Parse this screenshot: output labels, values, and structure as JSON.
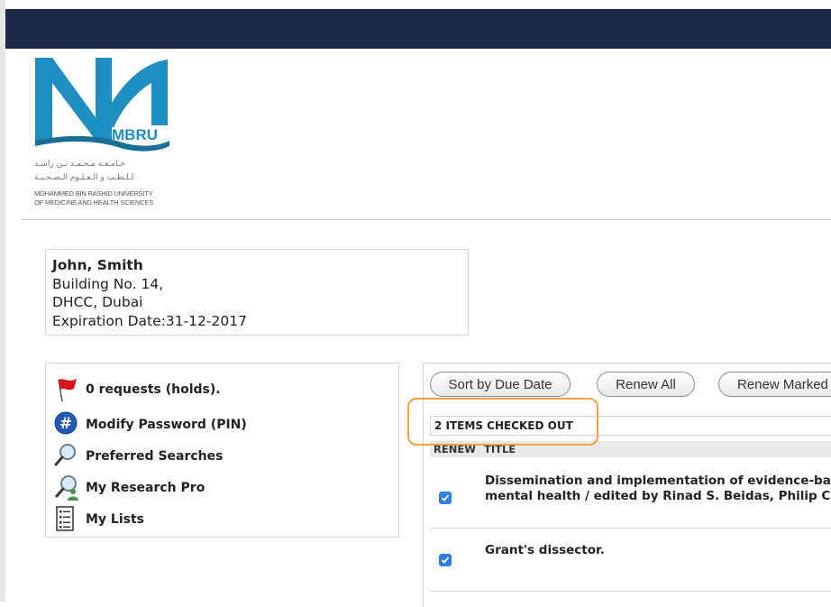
{
  "logo": {
    "acronym": "MBRU",
    "arabic_line1": "جـامـعـة مـحـمـد بـن راشـد",
    "arabic_line2": "لـلـطـب و الـعـلـوم الـصـحـيـة",
    "english_line1": "MOHAMMED BIN RASHID UNIVERSITY",
    "english_line2": "OF MEDICINE AND HEALTH SCIENCES",
    "brand_color": "#1f8fc1",
    "accent_color": "#1a6e96"
  },
  "patron": {
    "name": "John, Smith",
    "address_line1": "Building No. 14,",
    "address_line2": "DHCC, Dubai",
    "expiration": "Expiration Date:31-12-2017"
  },
  "menu": {
    "items": [
      {
        "label": "0 requests (holds).",
        "icon": "red-flag-icon"
      },
      {
        "label": "Modify Password (PIN)",
        "icon": "hash-icon"
      },
      {
        "label": "Preferred Searches",
        "icon": "magnifier-icon"
      },
      {
        "label": "My Research Pro",
        "icon": "magnifier-person-icon"
      },
      {
        "label": "My Lists",
        "icon": "list-icon"
      }
    ]
  },
  "toolbar": {
    "sort_label": "Sort by Due Date",
    "renew_all_label": "Renew All",
    "renew_marked_label": "Renew Marked"
  },
  "checkout": {
    "count_text": "2 ITEMS CHECKED OUT",
    "columns": [
      "RENEW",
      "TITLE"
    ],
    "rows": [
      {
        "checked": true,
        "title_line1": "Dissemination and implementation of evidence-based",
        "title_line2": "mental health / edited by Rinad S. Beidas, Philip C. K"
      },
      {
        "checked": true,
        "title_line1": "Grant's dissector.",
        "title_line2": ""
      }
    ]
  },
  "colors": {
    "topbar": "#1c2a47",
    "highlight": "#f3a040",
    "checkbox": "#2f7fe0"
  }
}
